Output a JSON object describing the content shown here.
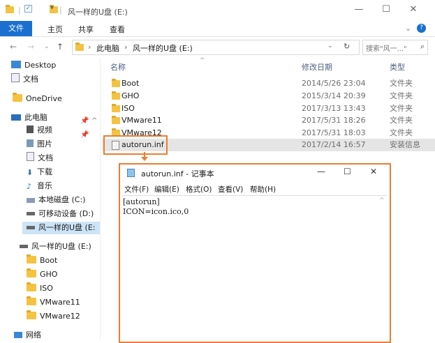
{
  "window": {
    "title": "风一样的U盘 (E:)"
  },
  "ribbon": {
    "file": "文件",
    "home": "主页",
    "share": "共享",
    "view": "查看"
  },
  "address": {
    "path": [
      "此电脑",
      "风一样的U盘 (E:)"
    ],
    "search_placeholder": "搜索\"风一...\""
  },
  "sidebar": {
    "items": [
      {
        "label": "Desktop"
      },
      {
        "label": "文档"
      },
      {
        "label": "OneDrive"
      },
      {
        "label": "此电脑"
      },
      {
        "label": "视频"
      },
      {
        "label": "图片"
      },
      {
        "label": "文档"
      },
      {
        "label": "下载"
      },
      {
        "label": "音乐"
      },
      {
        "label": "本地磁盘 (C:)"
      },
      {
        "label": "可移动设备 (D:)"
      },
      {
        "label": "风一样的U盘 (E:"
      },
      {
        "label": "风一样的U盘 (E:)"
      },
      {
        "label": "Boot"
      },
      {
        "label": "GHO"
      },
      {
        "label": "ISO"
      },
      {
        "label": "VMware11"
      },
      {
        "label": "VMware12"
      },
      {
        "label": "网络"
      }
    ]
  },
  "table": {
    "headers": {
      "name": "名称",
      "date": "修改日期",
      "type": "类型"
    },
    "rows": [
      {
        "name": "Boot",
        "date": "2014/5/26 23:04",
        "type": "文件夹"
      },
      {
        "name": "GHO",
        "date": "2015/3/14 20:39",
        "type": "文件夹"
      },
      {
        "name": "ISO",
        "date": "2017/3/13 13:43",
        "type": "文件夹"
      },
      {
        "name": "VMware11",
        "date": "2017/5/31 18:26",
        "type": "文件夹"
      },
      {
        "name": "VMware12",
        "date": "2017/5/31 18:03",
        "type": "文件夹"
      },
      {
        "name": "autorun.inf",
        "date": "2017/2/14 16:57",
        "type": "安装信息"
      }
    ]
  },
  "notepad": {
    "title": "autorun.inf - 记事本",
    "menu": [
      "文件(F)",
      "编辑(E)",
      "格式(O)",
      "查看(V)",
      "帮助(H)"
    ],
    "content": "[autorun]\nICON=icon.ico,0"
  },
  "colors": {
    "accent": "#1a6fcf",
    "callout": "#ed7d31",
    "folder": "#f5c342"
  }
}
